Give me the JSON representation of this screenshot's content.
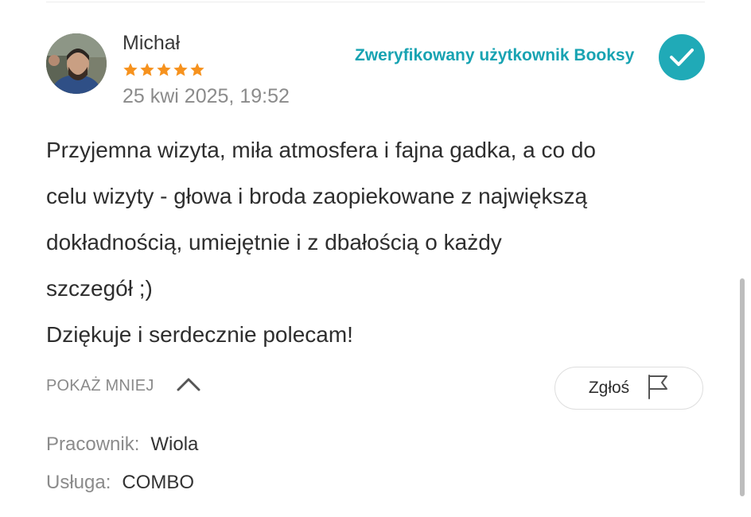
{
  "review": {
    "reviewer_name": "Michał",
    "rating": 5,
    "date": "25 kwi 2025, 19:52",
    "verified_label": "Zweryfikowany użytkownik Booksy",
    "text_lines": [
      "Przyjemna wizyta, miła atmosfera i fajna gadka, a co do",
      "celu wizyty - głowa i broda zaopiekowane z największą",
      "dokładnością, umiejętnie i z dbałością o każdy",
      "szczegół ;)",
      "Dziękuje i serdecznie polecam!"
    ]
  },
  "actions": {
    "show_less_label": "POKAŻ MNIEJ",
    "report_label": "Zgłoś"
  },
  "details": {
    "employee_key": "Pracownik:",
    "employee_value": "Wiola",
    "service_key": "Usługa:",
    "service_value": "COMBO"
  },
  "colors": {
    "accent": "#20aab7",
    "star": "#f6921e"
  },
  "icons": {
    "verified": "check-circle-icon",
    "show_less": "chevron-up-icon",
    "report": "flag-icon",
    "star": "star-icon"
  }
}
